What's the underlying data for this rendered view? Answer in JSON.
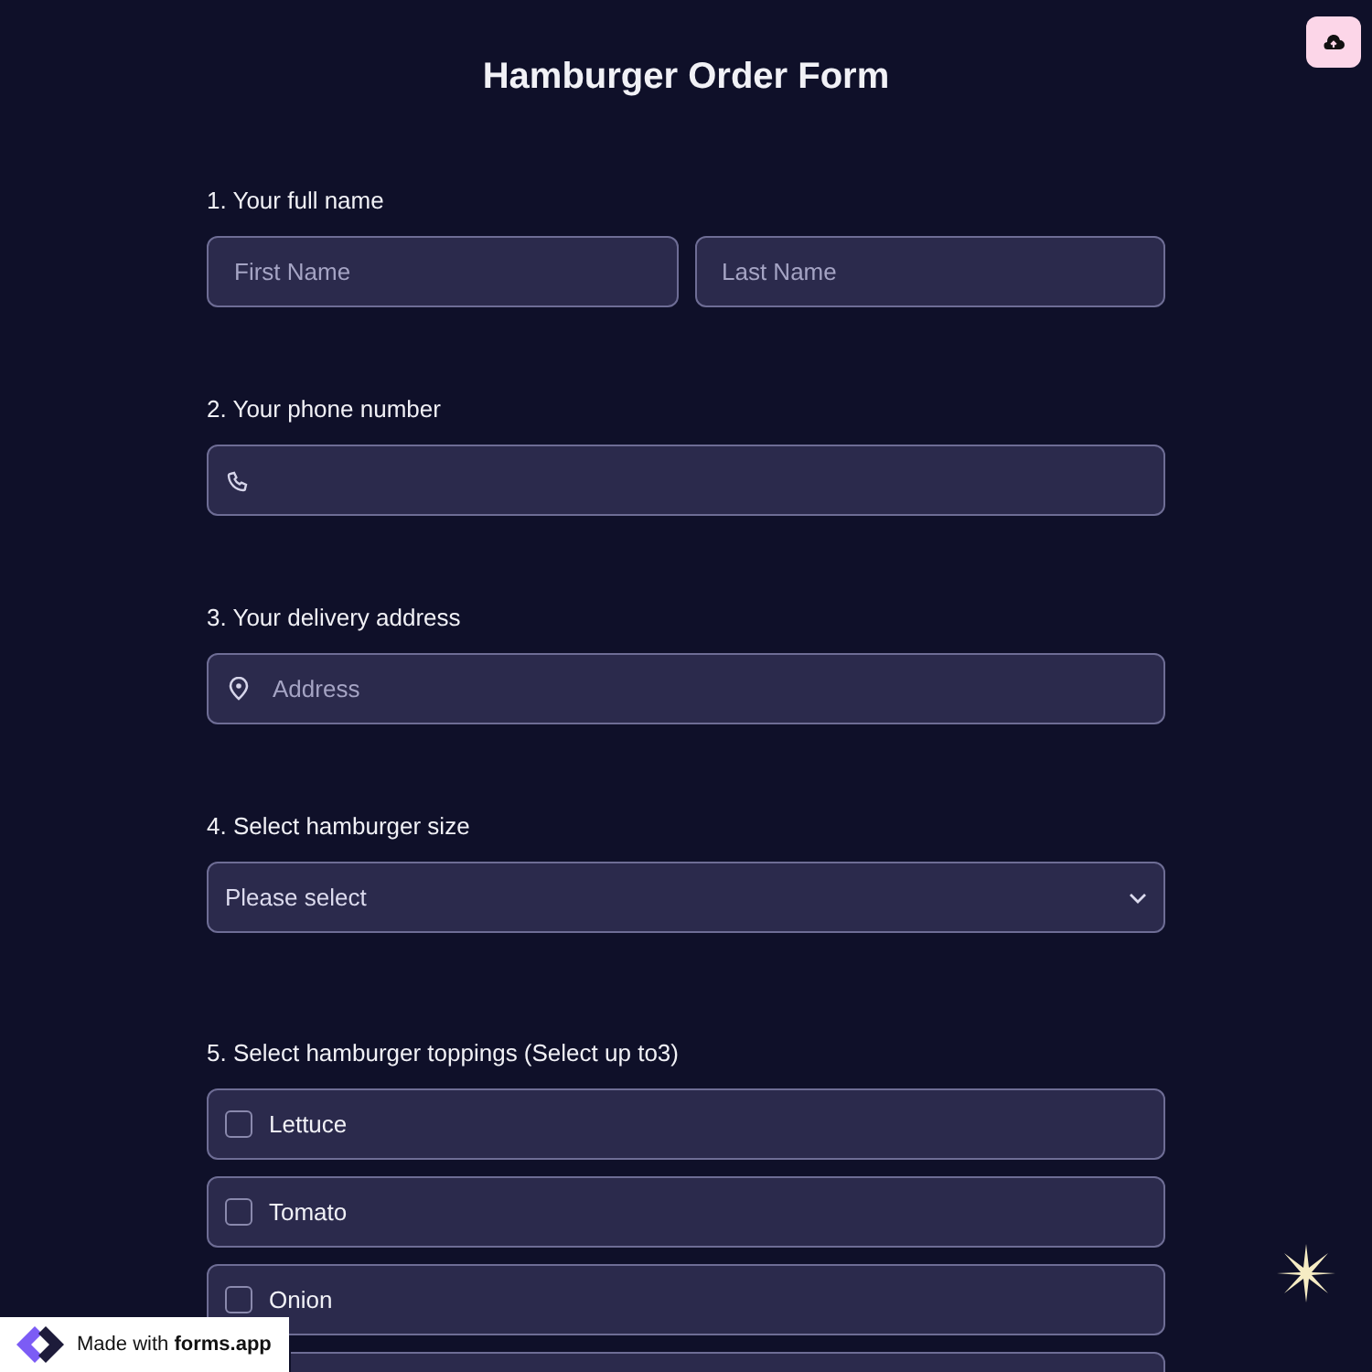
{
  "title": "Hamburger Order Form",
  "questions": [
    {
      "kind": "name",
      "label": "1.  Your full name",
      "fields": [
        {
          "placeholder": "First Name"
        },
        {
          "placeholder": "Last Name"
        }
      ]
    },
    {
      "kind": "phone",
      "label": "2. Your phone number"
    },
    {
      "kind": "address",
      "label": "3. Your delivery address",
      "placeholder": "Address"
    },
    {
      "kind": "select",
      "label": "4. Select hamburger size",
      "value": "Please select"
    },
    {
      "kind": "checkboxes",
      "label": "5. Select hamburger toppings (Select up to3)",
      "options": [
        {
          "label": "Lettuce",
          "checked": false
        },
        {
          "label": "Tomato",
          "checked": false
        },
        {
          "label": "Onion",
          "checked": false
        }
      ]
    }
  ],
  "badge": "Made with **forms.app**"
}
